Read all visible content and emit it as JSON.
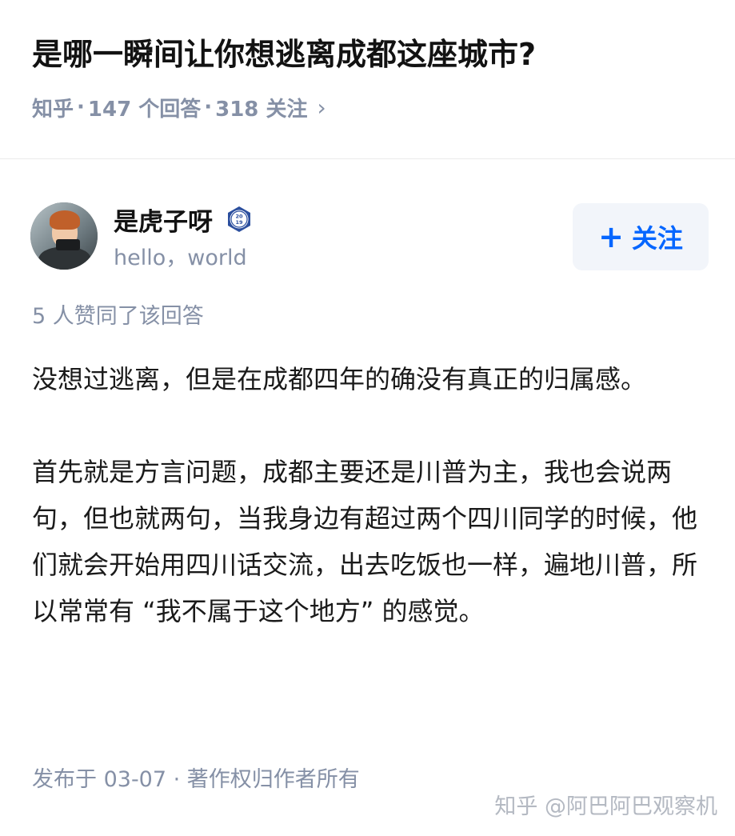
{
  "question": {
    "title": "是哪一瞬间让你想逃离成都这座城市?",
    "source": "知乎",
    "answers_count": "147 个回答",
    "followers_count": "318 关注",
    "chevron": "›"
  },
  "author": {
    "name": "是虎子呀",
    "badge_text": "2019",
    "bio": "hello，world",
    "follow_label": "关注",
    "follow_icon": "+"
  },
  "votes_text": "5 人赞同了该回答",
  "answer": {
    "paragraphs": [
      "没想过逃离，但是在成都四年的确没有真正的归属感。",
      "首先就是方言问题，成都主要还是川普为主，我也会说两句，但也就两句，当我身边有超过两个四川同学的时候，他们就会开始用四川话交流，出去吃饭也一样，遍地川普，所以常常有 “我不属于这个地方” 的感觉。"
    ]
  },
  "footer": {
    "published": "发布于 03-07 · 著作权归作者所有"
  },
  "watermark": "知乎 @阿巴阿巴观察机",
  "colors": {
    "accent": "#0566ff",
    "muted": "#8590a6",
    "button_bg": "#f2f5fa"
  }
}
